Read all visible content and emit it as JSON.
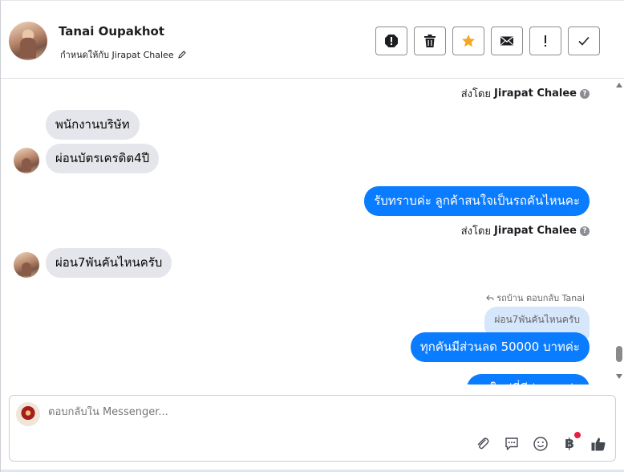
{
  "header": {
    "contact_name": "Tanai Oupakhot",
    "assigned_label": "กำหนดให้กับ Jirapat Chalee",
    "actions": [
      "spam-icon",
      "trash-icon",
      "star-icon",
      "envelope-icon",
      "exclamation-icon",
      "check-icon"
    ]
  },
  "thread": {
    "sent_by_prefix": "ส่งโดย",
    "sent_by_name": "Jirapat Chalee",
    "help": "?",
    "messages": [
      {
        "dir": "in",
        "text": "พนักงานบริษัท"
      },
      {
        "dir": "in",
        "text": "ผ่อนบัตรเครดิต4ปี"
      },
      {
        "dir": "out",
        "text": "รับทราบค่ะ ลูกค้าสนใจเป็นรถคันไหนคะ"
      },
      {
        "dir": "in",
        "text": "ผ่อน7พันคันไหนครับ"
      },
      {
        "dir": "out",
        "text": "ทุกคันมีส่วนลด 50000 บาทค่ะ"
      },
      {
        "dir": "out",
        "text": "รถใหม่ที่มีส่วนลดค่ะ"
      }
    ],
    "reply_meta": "รถบ้าน ตอบกลับ Tanai",
    "quoted_text": "ผ่อน7พันคันไหนครับ"
  },
  "composer": {
    "placeholder": "ตอบกลับใน Messenger...",
    "tools": [
      "paperclip-icon",
      "saved-reply-icon",
      "emoji-icon",
      "baht-icon",
      "thumbs-up-icon"
    ],
    "baht_symbol": "฿"
  },
  "colors": {
    "outgoing": "#0a7cff",
    "incoming": "#e4e6eb",
    "star": "#f5a623",
    "quoted": "#d6e6fb"
  }
}
